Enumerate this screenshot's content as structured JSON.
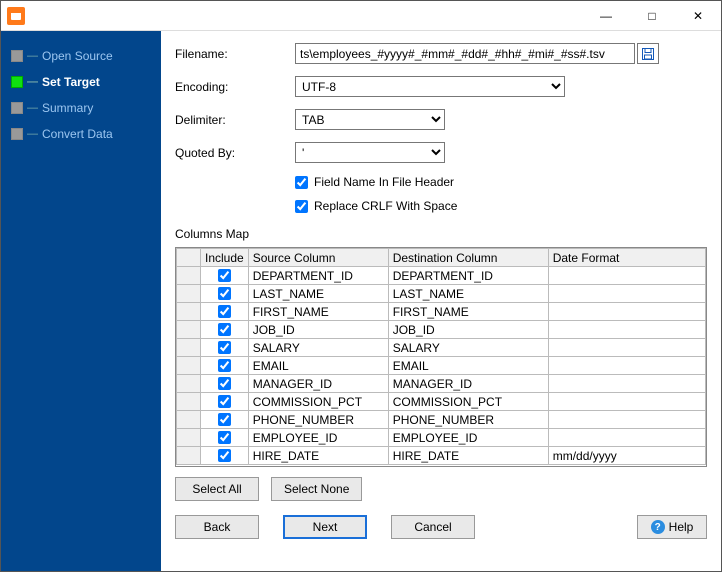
{
  "titlebar": {
    "app_icon_name": "app"
  },
  "window_controls": {
    "min": "—",
    "max": "□",
    "close": "✕"
  },
  "sidebar": {
    "items": [
      {
        "label": "Open Source",
        "active": false
      },
      {
        "label": "Set Target",
        "active": true
      },
      {
        "label": "Summary",
        "active": false
      },
      {
        "label": "Convert Data",
        "active": false
      }
    ]
  },
  "form": {
    "filename_label": "Filename:",
    "filename_value": "ts\\employees_#yyyy#_#mm#_#dd#_#hh#_#mi#_#ss#.tsv",
    "encoding_label": "Encoding:",
    "encoding_value": "UTF-8",
    "delimiter_label": "Delimiter:",
    "delimiter_value": "TAB",
    "quoted_label": "Quoted By:",
    "quoted_value": "'",
    "field_header_label": "Field Name In File Header",
    "field_header_checked": true,
    "replace_crlf_label": "Replace CRLF With Space",
    "replace_crlf_checked": true
  },
  "columns_map": {
    "label": "Columns Map",
    "headers": {
      "include": "Include",
      "source": "Source Column",
      "dest": "Destination Column",
      "date_format": "Date Format"
    },
    "rows": [
      {
        "include": true,
        "source": "DEPARTMENT_ID",
        "dest": "DEPARTMENT_ID",
        "date_format": ""
      },
      {
        "include": true,
        "source": "LAST_NAME",
        "dest": "LAST_NAME",
        "date_format": ""
      },
      {
        "include": true,
        "source": "FIRST_NAME",
        "dest": "FIRST_NAME",
        "date_format": ""
      },
      {
        "include": true,
        "source": "JOB_ID",
        "dest": "JOB_ID",
        "date_format": ""
      },
      {
        "include": true,
        "source": "SALARY",
        "dest": "SALARY",
        "date_format": ""
      },
      {
        "include": true,
        "source": "EMAIL",
        "dest": "EMAIL",
        "date_format": ""
      },
      {
        "include": true,
        "source": "MANAGER_ID",
        "dest": "MANAGER_ID",
        "date_format": ""
      },
      {
        "include": true,
        "source": "COMMISSION_PCT",
        "dest": "COMMISSION_PCT",
        "date_format": ""
      },
      {
        "include": true,
        "source": "PHONE_NUMBER",
        "dest": "PHONE_NUMBER",
        "date_format": ""
      },
      {
        "include": true,
        "source": "EMPLOYEE_ID",
        "dest": "EMPLOYEE_ID",
        "date_format": ""
      },
      {
        "include": true,
        "source": "HIRE_DATE",
        "dest": "HIRE_DATE",
        "date_format": "mm/dd/yyyy"
      }
    ]
  },
  "buttons": {
    "select_all": "Select All",
    "select_none": "Select None",
    "back": "Back",
    "next": "Next",
    "cancel": "Cancel",
    "help": "Help"
  }
}
